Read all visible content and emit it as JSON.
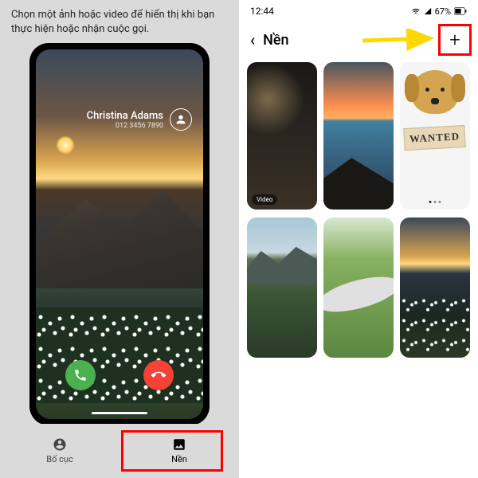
{
  "left": {
    "instruction": "Chọn một ảnh hoặc video để hiển thị khi bạn thực hiện hoặc nhận cuộc gọi.",
    "caller_name": "Christina Adams",
    "caller_number": "012 3456 7890",
    "tabs": {
      "layout": "Bố cục",
      "background": "Nền"
    }
  },
  "right": {
    "status": {
      "time": "12:44",
      "battery": "67%"
    },
    "header": {
      "title": "Nền"
    },
    "video_badge": "Video",
    "wanted_label": "WANTED"
  }
}
